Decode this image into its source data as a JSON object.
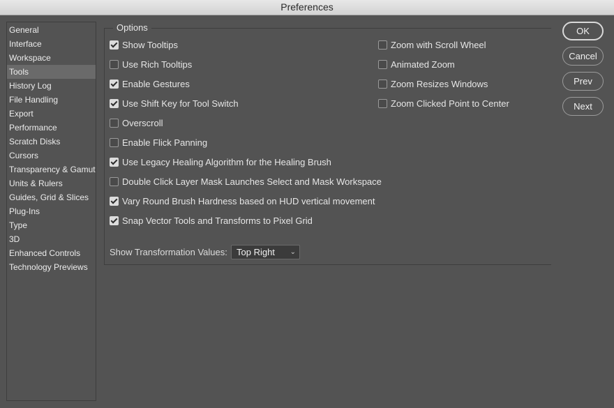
{
  "window": {
    "title": "Preferences"
  },
  "sidebar": {
    "items": [
      {
        "label": "General",
        "selected": false
      },
      {
        "label": "Interface",
        "selected": false
      },
      {
        "label": "Workspace",
        "selected": false
      },
      {
        "label": "Tools",
        "selected": true
      },
      {
        "label": "History Log",
        "selected": false
      },
      {
        "label": "File Handling",
        "selected": false
      },
      {
        "label": "Export",
        "selected": false
      },
      {
        "label": "Performance",
        "selected": false
      },
      {
        "label": "Scratch Disks",
        "selected": false
      },
      {
        "label": "Cursors",
        "selected": false
      },
      {
        "label": "Transparency & Gamut",
        "selected": false
      },
      {
        "label": "Units & Rulers",
        "selected": false
      },
      {
        "label": "Guides, Grid & Slices",
        "selected": false
      },
      {
        "label": "Plug-Ins",
        "selected": false
      },
      {
        "label": "Type",
        "selected": false
      },
      {
        "label": "3D",
        "selected": false
      },
      {
        "label": "Enhanced Controls",
        "selected": false
      },
      {
        "label": "Technology Previews",
        "selected": false
      }
    ]
  },
  "options": {
    "legend": "Options",
    "left_column": [
      {
        "label": "Show Tooltips",
        "checked": true
      },
      {
        "label": "Use Rich Tooltips",
        "checked": false
      },
      {
        "label": "Enable Gestures",
        "checked": true
      },
      {
        "label": "Use Shift Key for Tool Switch",
        "checked": true
      },
      {
        "label": "Overscroll",
        "checked": false
      },
      {
        "label": "Enable Flick Panning",
        "checked": false
      },
      {
        "label": "Use Legacy Healing Algorithm for the Healing Brush",
        "checked": true
      },
      {
        "label": "Double Click Layer Mask Launches Select and Mask Workspace",
        "checked": false
      },
      {
        "label": "Vary Round Brush Hardness based on HUD vertical movement",
        "checked": true
      },
      {
        "label": "Snap Vector Tools and Transforms to Pixel Grid",
        "checked": true
      }
    ],
    "right_column": [
      {
        "label": "Zoom with Scroll Wheel",
        "checked": false
      },
      {
        "label": "Animated Zoom",
        "checked": false
      },
      {
        "label": "Zoom Resizes Windows",
        "checked": false
      },
      {
        "label": "Zoom Clicked Point to Center",
        "checked": false
      }
    ],
    "transformation": {
      "label": "Show Transformation Values:",
      "value": "Top Right"
    }
  },
  "buttons": {
    "ok": "OK",
    "cancel": "Cancel",
    "prev": "Prev",
    "next": "Next"
  }
}
